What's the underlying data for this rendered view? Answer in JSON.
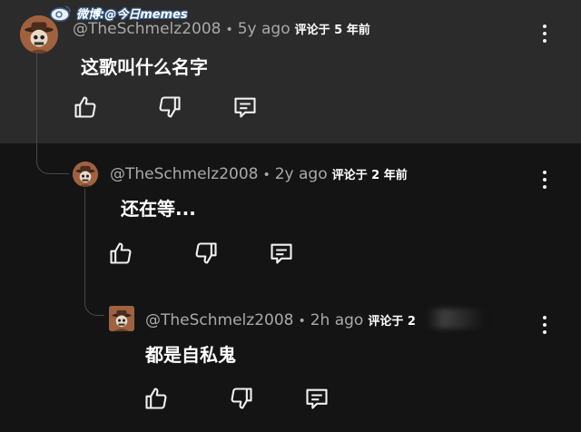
{
  "watermark": {
    "text": "微博:@今日memes"
  },
  "comments": [
    {
      "handle": "@TheSchmelz2008",
      "age": "5y ago",
      "cn_age": "评论于 5 年前",
      "text": "这歌叫什么名字",
      "avatar_icon": "cowboy-avatar"
    },
    {
      "handle": "@TheSchmelz2008",
      "age": "2y ago",
      "cn_age": "评论于 2 年前",
      "text": "还在等...",
      "avatar_icon": "cowboy-avatar"
    },
    {
      "handle": "@TheSchmelz2008",
      "age": "2h ago",
      "cn_age": "评论于 2",
      "text": "都是自私鬼",
      "avatar_icon": "cowboy-avatar"
    }
  ],
  "icons": {
    "like": "thumbs-up-icon",
    "dislike": "thumbs-down-icon",
    "reply": "reply-comment-icon",
    "more": "more-vertical-icon"
  },
  "colors": {
    "top_band": "#2b2b2b",
    "bottom_band": "#141414",
    "meta_text": "#a9a9a9",
    "body_text": "#ffffff",
    "avatar": "#a0613f"
  }
}
